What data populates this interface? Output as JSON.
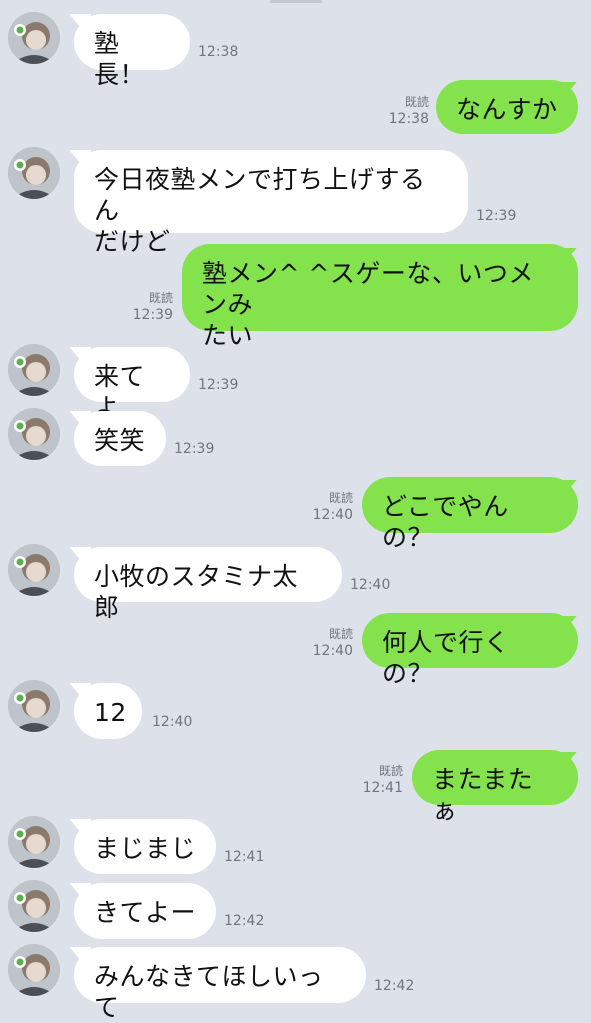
{
  "messages": [
    {
      "side": "in",
      "text": "塾長！",
      "time": "12:38"
    },
    {
      "side": "out",
      "text": "なんすか",
      "time": "12:38",
      "read": "既読"
    },
    {
      "side": "in",
      "text": "今日夜塾メンで打ち上げするん\nだけど",
      "time": "12:39"
    },
    {
      "side": "out",
      "text": "塾メン^ ^スゲーな、いつメンみ\nたい",
      "time": "12:39",
      "read": "既読"
    },
    {
      "side": "in",
      "text": "来てよ",
      "time": "12:39"
    },
    {
      "side": "in",
      "text": "笑笑",
      "time": "12:39"
    },
    {
      "side": "out",
      "text": "どこでやんの？",
      "time": "12:40",
      "read": "既読"
    },
    {
      "side": "in",
      "text": "小牧のスタミナ太郎",
      "time": "12:40"
    },
    {
      "side": "out",
      "text": "何人で行くの？",
      "time": "12:40",
      "read": "既読"
    },
    {
      "side": "in",
      "text": "12",
      "time": "12:40"
    },
    {
      "side": "out",
      "text": "またまたぁ",
      "time": "12:41",
      "read": "既読"
    },
    {
      "side": "in",
      "text": "まじまじ",
      "time": "12:41"
    },
    {
      "side": "in",
      "text": "きてよー",
      "time": "12:42"
    },
    {
      "side": "in",
      "text": "みんなきてほしいって",
      "time": "12:42"
    }
  ],
  "colors": {
    "background": "#dde2ea",
    "incoming": "#ffffff",
    "outgoing": "#84e34c"
  }
}
